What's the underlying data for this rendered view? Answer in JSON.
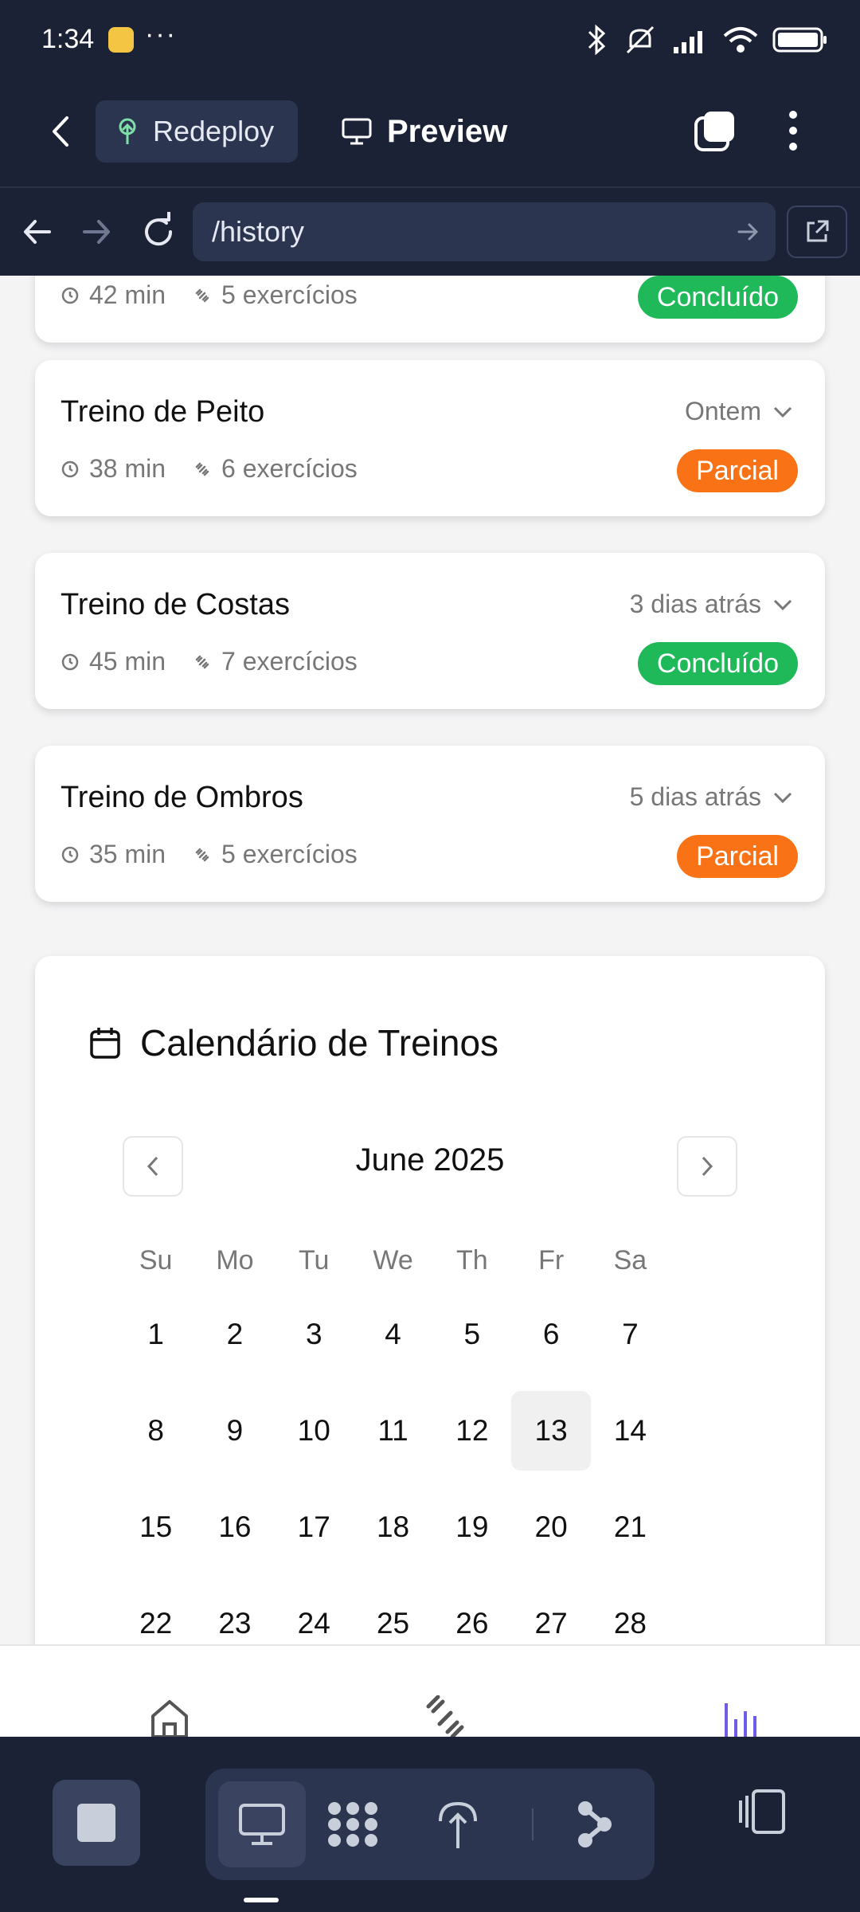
{
  "status_bar": {
    "time": "1:34",
    "more": "···"
  },
  "toolbar": {
    "redeploy_label": "Redeploy",
    "preview_label": "Preview"
  },
  "url_bar": {
    "path": "/history"
  },
  "partial_card": {
    "duration": "42 min",
    "exercises": "5 exercícios",
    "status": "Concluído"
  },
  "workouts": [
    {
      "title": "Treino de Peito",
      "duration": "38 min",
      "exercises": "6 exercícios",
      "when": "Ontem",
      "status": "Parcial",
      "status_color": "#f97316"
    },
    {
      "title": "Treino de Costas",
      "duration": "45 min",
      "exercises": "7 exercícios",
      "when": "3 dias atrás",
      "status": "Concluído",
      "status_color": "#1fb95a"
    },
    {
      "title": "Treino de Ombros",
      "duration": "35 min",
      "exercises": "5 exercícios",
      "when": "5 dias atrás",
      "status": "Parcial",
      "status_color": "#f97316"
    }
  ],
  "calendar": {
    "title": "Calendário de Treinos",
    "month": "June 2025",
    "weekdays": [
      "Su",
      "Mo",
      "Tu",
      "We",
      "Th",
      "Fr",
      "Sa"
    ],
    "weeks": [
      [
        "1",
        "2",
        "3",
        "4",
        "5",
        "6",
        "7"
      ],
      [
        "8",
        "9",
        "10",
        "11",
        "12",
        "13",
        "14"
      ],
      [
        "15",
        "16",
        "17",
        "18",
        "19",
        "20",
        "21"
      ],
      [
        "22",
        "23",
        "24",
        "25",
        "26",
        "27",
        "28"
      ]
    ],
    "selected_day": "13"
  },
  "colors": {
    "dark_bg": "#1b2236",
    "accent": "#6d5ce7",
    "green": "#1fb95a",
    "orange": "#f97316"
  }
}
